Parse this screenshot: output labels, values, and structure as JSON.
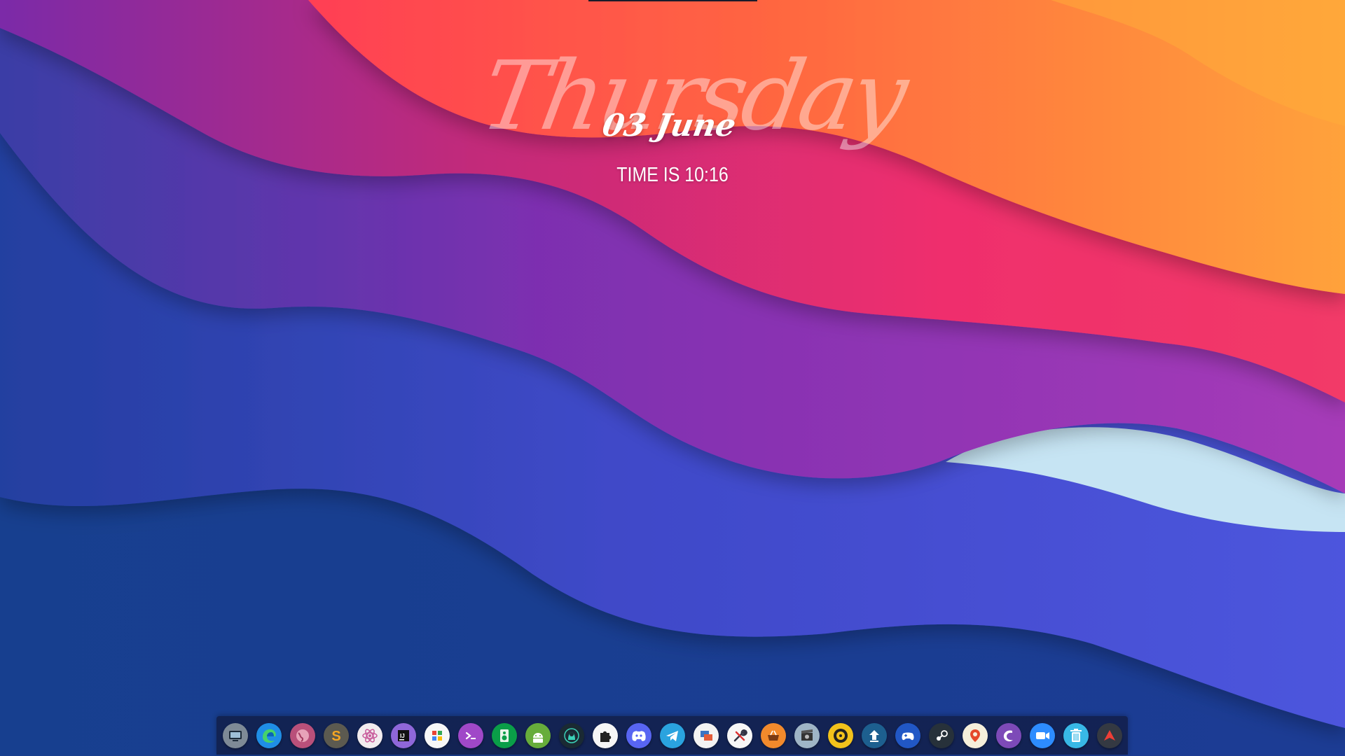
{
  "clock": {
    "day": "Thursday",
    "date": "03 June",
    "time": "TIME IS 10:16"
  },
  "dock": {
    "apps": [
      {
        "name": "computer-icon",
        "color": "#7e8a96"
      },
      {
        "name": "edge-browser-icon",
        "color": "#1f8ee6"
      },
      {
        "name": "globe-app-icon",
        "color": "#b9507a"
      },
      {
        "name": "sublime-s-icon",
        "color": "#5c5a50"
      },
      {
        "name": "atom-editor-icon",
        "color": "#f2ecef"
      },
      {
        "name": "intellij-icon",
        "color": "#8f67d9"
      },
      {
        "name": "app-grid-icon",
        "color": "#f7f7f7"
      },
      {
        "name": "terminal-icon",
        "color": "#a048c8"
      },
      {
        "name": "audio-app-icon",
        "color": "#0a9e48"
      },
      {
        "name": "android-icon",
        "color": "#67ad3b"
      },
      {
        "name": "gitkraken-icon",
        "color": "#1a2a33"
      },
      {
        "name": "puzzle-icon",
        "color": "#f6f6f6"
      },
      {
        "name": "discord-icon",
        "color": "#5865f2"
      },
      {
        "name": "telegram-icon",
        "color": "#2aa3df"
      },
      {
        "name": "remote-desktop-icon",
        "color": "#f3f3f3"
      },
      {
        "name": "tools-icon",
        "color": "#f7f7f7"
      },
      {
        "name": "basket-icon",
        "color": "#f28a2c"
      },
      {
        "name": "video-editor-icon",
        "color": "#9fb5c6"
      },
      {
        "name": "music-disc-icon",
        "color": "#f2c21b"
      },
      {
        "name": "upload-icon",
        "color": "#1d5f8f"
      },
      {
        "name": "gamepad-icon",
        "color": "#2157c5"
      },
      {
        "name": "steam-icon",
        "color": "#27313a"
      },
      {
        "name": "maps-pin-icon",
        "color": "#f5efdb"
      },
      {
        "name": "swirl-app-icon",
        "color": "#7d4ab8"
      },
      {
        "name": "zoom-icon",
        "color": "#2d8cff"
      },
      {
        "name": "trash-icon",
        "color": "#38b8e6"
      },
      {
        "name": "launcher-arrow-icon",
        "color": "#343942"
      }
    ]
  }
}
